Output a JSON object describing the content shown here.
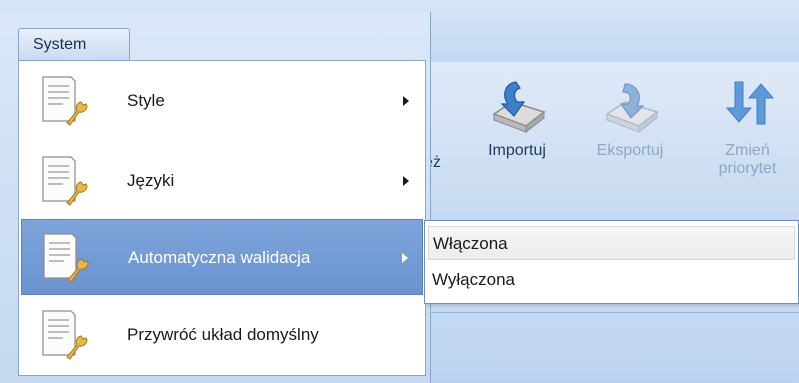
{
  "system_tab": {
    "label": "System"
  },
  "menu": {
    "items": [
      {
        "label": "Style",
        "icon": "document-wrench-icon",
        "has_submenu": true,
        "active": false
      },
      {
        "label": "Języki",
        "icon": "document-wrench-icon",
        "has_submenu": true,
        "active": false
      },
      {
        "label": "Automatyczna walidacja",
        "icon": "document-wrench-icon",
        "has_submenu": true,
        "active": true
      },
      {
        "label": "Przywróć układ domyślny",
        "icon": "document-wrench-icon",
        "has_submenu": false,
        "active": false
      }
    ]
  },
  "submenu": {
    "items": [
      {
        "label": "Włączona",
        "highlighted": true
      },
      {
        "label": "Wyłączona",
        "highlighted": false
      }
    ]
  },
  "ribbon": {
    "partial_label": "eż",
    "buttons": [
      {
        "label": "Importuj",
        "icon": "import-icon",
        "enabled": true
      },
      {
        "label": "Eksportuj",
        "icon": "export-icon",
        "enabled": false
      },
      {
        "label_line1": "Zmień",
        "label_line2": "priorytet",
        "icon": "change-priority-icon",
        "enabled": false
      }
    ]
  },
  "colors": {
    "menu_active": "#7ea4da",
    "ribbon_bg": "#c9dbf1",
    "accent_blue": "#3f7fc8"
  }
}
